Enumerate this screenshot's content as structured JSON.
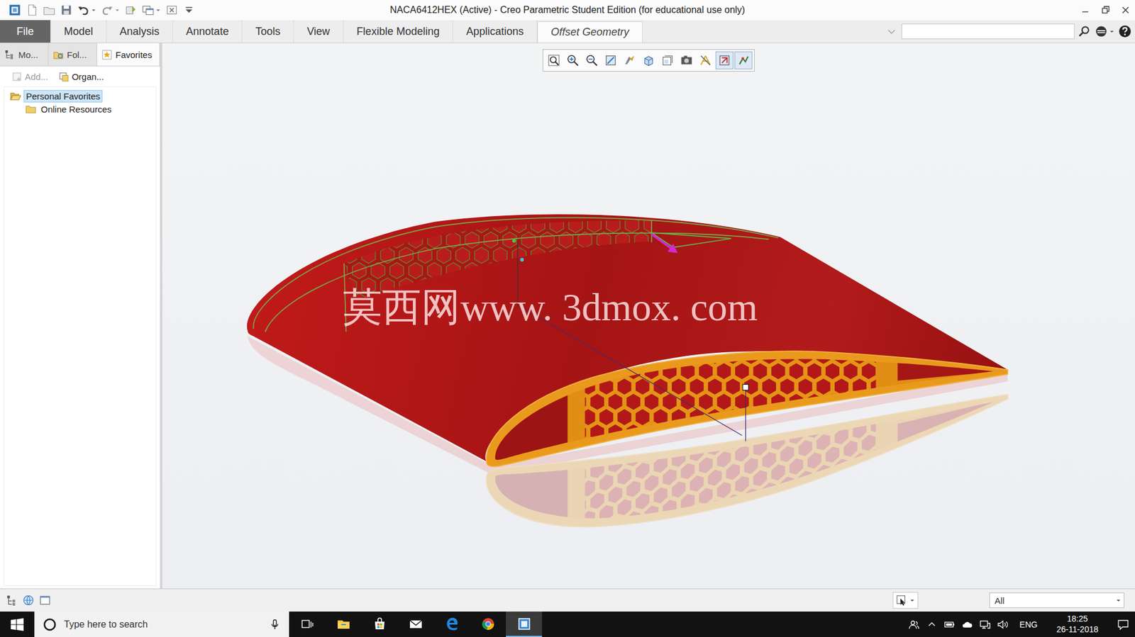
{
  "window": {
    "title": "NACA6412HEX (Active) - Creo Parametric Student Edition (for educational use only)"
  },
  "ribbon_tabs": [
    {
      "label": "File",
      "kind": "file",
      "selected": false
    },
    {
      "label": "Model",
      "kind": "tab",
      "selected": false
    },
    {
      "label": "Analysis",
      "kind": "tab",
      "selected": false
    },
    {
      "label": "Annotate",
      "kind": "tab",
      "selected": false
    },
    {
      "label": "Tools",
      "kind": "tab",
      "selected": false
    },
    {
      "label": "View",
      "kind": "tab",
      "selected": false
    },
    {
      "label": "Flexible Modeling",
      "kind": "tab",
      "selected": false
    },
    {
      "label": "Applications",
      "kind": "tab",
      "selected": false
    },
    {
      "label": "Offset Geometry",
      "kind": "contextual",
      "selected": true
    }
  ],
  "sidebar": {
    "tabs": [
      {
        "label": "Mo...",
        "kind": "model-tree",
        "selected": false
      },
      {
        "label": "Fol...",
        "kind": "folder",
        "selected": false
      },
      {
        "label": "Favorites",
        "kind": "favorites",
        "selected": true
      }
    ],
    "toolbar": [
      {
        "label": "Add...",
        "kind": "add",
        "disabled": true
      },
      {
        "label": "Organ...",
        "kind": "organize",
        "disabled": false
      }
    ],
    "tree": [
      {
        "label": "Personal Favorites",
        "selected": true,
        "expanded": true,
        "children": [
          {
            "label": "Online Resources",
            "selected": false
          }
        ]
      }
    ]
  },
  "view_toolbar": [
    {
      "kind": "refit",
      "on": false
    },
    {
      "kind": "zoom-in",
      "on": false
    },
    {
      "kind": "zoom-out",
      "on": false
    },
    {
      "kind": "repaint",
      "on": false
    },
    {
      "kind": "display-style",
      "on": false
    },
    {
      "kind": "saved-orientations",
      "on": false
    },
    {
      "kind": "view-manager",
      "on": false
    },
    {
      "kind": "perspective",
      "on": false
    },
    {
      "kind": "datum-display",
      "on": false
    },
    {
      "kind": "spin-center",
      "on": true
    },
    {
      "kind": "annotation",
      "on": true
    }
  ],
  "viewport": {
    "watermark": "莫西网www. 3dmox. com"
  },
  "status_bar": {
    "filter": "All"
  },
  "taskbar": {
    "search_placeholder": "Type here to search",
    "apps": [
      {
        "kind": "task-view",
        "selected": false
      },
      {
        "kind": "explorer",
        "selected": false
      },
      {
        "kind": "store",
        "selected": false
      },
      {
        "kind": "mail",
        "selected": false
      },
      {
        "kind": "edge",
        "selected": false
      },
      {
        "kind": "chrome",
        "selected": false
      },
      {
        "kind": "creo",
        "selected": true
      }
    ],
    "language": "ENG",
    "time": "18:25",
    "date": "26-11-2018"
  }
}
